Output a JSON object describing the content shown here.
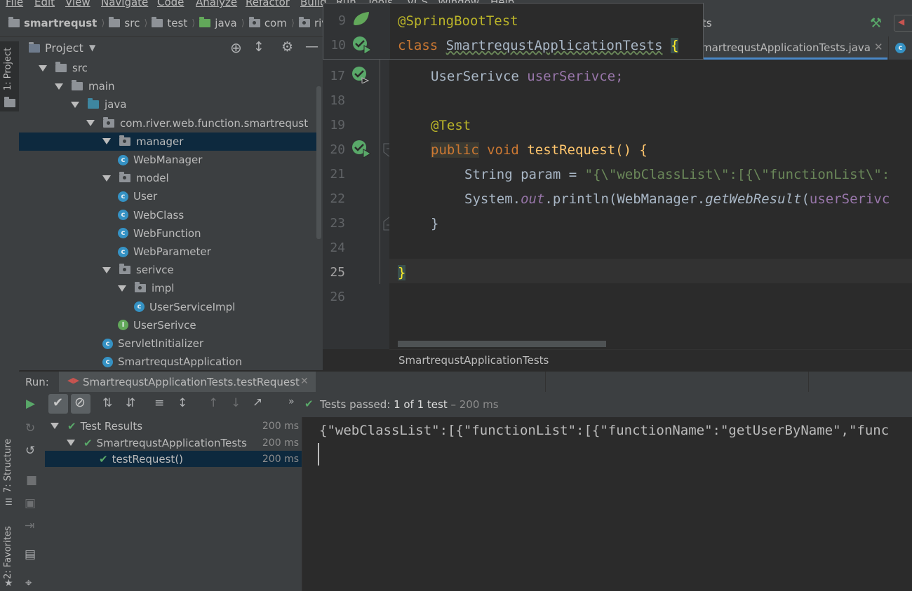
{
  "menu": [
    "File",
    "Edit",
    "View",
    "Navigate",
    "Code",
    "Analyze",
    "Refactor",
    "Build",
    "Run",
    "Tools",
    "VCS",
    "Window",
    "Help"
  ],
  "navbar": {
    "project": "smartrequst",
    "crumbs": [
      "src",
      "test",
      "java",
      "com",
      "rive"
    ],
    "tab_suffix": "ts"
  },
  "left_strip": {
    "project_tab": "1: Project",
    "structure_tab": "7: Structure",
    "favorites_tab": "2: Favorites"
  },
  "project_panel": {
    "title": "Project",
    "tree": [
      {
        "label": "src",
        "indent": 0,
        "kind": "folder"
      },
      {
        "label": "main",
        "indent": 1,
        "kind": "folder"
      },
      {
        "label": "java",
        "indent": 2,
        "kind": "folder-blue"
      },
      {
        "label": "com.river.web.function.smartrequst",
        "indent": 3,
        "kind": "package"
      },
      {
        "label": "manager",
        "indent": 4,
        "kind": "package",
        "selected": true
      },
      {
        "label": "WebManager",
        "indent": 5,
        "kind": "class"
      },
      {
        "label": "model",
        "indent": 4,
        "kind": "package"
      },
      {
        "label": "User",
        "indent": 5,
        "kind": "class"
      },
      {
        "label": "WebClass",
        "indent": 5,
        "kind": "class"
      },
      {
        "label": "WebFunction",
        "indent": 5,
        "kind": "class"
      },
      {
        "label": "WebParameter",
        "indent": 5,
        "kind": "class"
      },
      {
        "label": "serivce",
        "indent": 4,
        "kind": "package"
      },
      {
        "label": "impl",
        "indent": 5,
        "kind": "package"
      },
      {
        "label": "UserServiceImpl",
        "indent": 6,
        "kind": "class"
      },
      {
        "label": "UserSerivce",
        "indent": 5,
        "kind": "interface"
      },
      {
        "label": "ServletInitializer",
        "indent": 4,
        "kind": "class"
      },
      {
        "label": "SmartrequstApplication",
        "indent": 4,
        "kind": "class"
      }
    ]
  },
  "editor": {
    "tab_label": "martrequstApplicationTests.java",
    "popup": {
      "lines": [
        {
          "num": "9",
          "text": "@SpringBootTest"
        },
        {
          "num": "10",
          "text_kw": "class",
          "text_name": "SmartrequstApplicationTests",
          "text_brace": "{"
        }
      ]
    },
    "lines": [
      {
        "num": "17"
      },
      {
        "num": "18"
      },
      {
        "num": "19"
      },
      {
        "num": "20"
      },
      {
        "num": "21"
      },
      {
        "num": "22"
      },
      {
        "num": "23"
      },
      {
        "num": "24"
      },
      {
        "num": "25"
      },
      {
        "num": "26"
      }
    ],
    "code": {
      "l17_type": "UserSerivce",
      "l17_field": "userSerivce;",
      "l19_ann": "@Test",
      "l20_public": "public",
      "l20_void": "void",
      "l20_name": "testRequest() {",
      "l21_pre": "String param = ",
      "l21_str": "\"{\\\"webClassList\\\":[{\\\"functionList\\\":",
      "l22_a": "System.",
      "l22_out": "out",
      "l22_b": ".println(WebManager.",
      "l22_method": "getWebResult",
      "l22_c": "(",
      "l22_arg": "userSerivc",
      "l23": "}",
      "l25": "}"
    },
    "footer_crumb": "SmartrequstApplicationTests"
  },
  "run": {
    "label": "Run:",
    "tab": "SmartrequstApplicationTests.testRequest",
    "status_prefix": "Tests passed:",
    "status_value": "1 of 1 test",
    "status_time": "– 200 ms",
    "results": [
      {
        "label": "Test Results",
        "time": "200 ms",
        "indent": 0
      },
      {
        "label": "SmartrequstApplicationTests",
        "time": "200 ms",
        "indent": 1
      },
      {
        "label": "testRequest()",
        "time": "200 ms",
        "indent": 2,
        "selected": true
      }
    ],
    "console_output": "{\"webClassList\":[{\"functionList\":[{\"functionName\":\"getUserByName\",\"func"
  }
}
